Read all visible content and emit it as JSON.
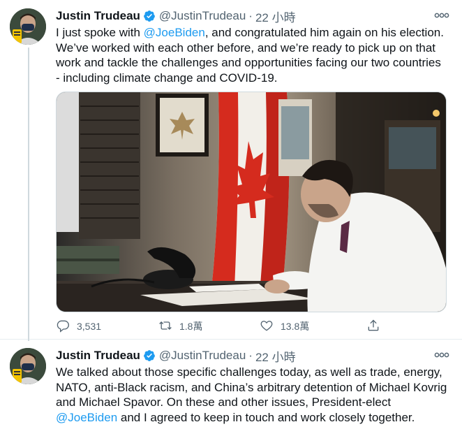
{
  "tweets": [
    {
      "author": {
        "name": "Justin Trudeau",
        "handle": "@JustinTrudeau",
        "time": "22 小時",
        "separator": "·"
      },
      "text_parts": [
        "I just spoke with ",
        "@JoeBiden",
        ", and congratulated him again on his election. We’ve worked with each other before, and we’re ready to pick up on that work and tackle the challenges and opportunities facing our two countries - including climate change and COVID-19."
      ],
      "media": {
        "alt": "Justin Trudeau on a phone call at his desk, Canadian flag behind him"
      },
      "actions": {
        "replies": "3,531",
        "retweets": "1.8萬",
        "likes": "13.8萬"
      }
    },
    {
      "author": {
        "name": "Justin Trudeau",
        "handle": "@JustinTrudeau",
        "time": "22 小時",
        "separator": "·"
      },
      "text_parts": [
        "We talked about those specific challenges today, as well as trade, energy, NATO, anti-Black racism, and China’s arbitrary detention of Michael Kovrig and Michael Spavor. On these and other issues, President-elect ",
        "@JoeBiden",
        " and I agreed to keep in touch and work closely together."
      ]
    }
  ],
  "colors": {
    "accent": "#1d9bf0",
    "text": "#0f1419",
    "secondary": "#536471",
    "verified": "#1d9bf0",
    "flag_red": "#d52b1e"
  },
  "icons": [
    "verified-badge-icon",
    "more-options-icon",
    "reply-icon",
    "retweet-icon",
    "like-icon",
    "share-icon"
  ]
}
